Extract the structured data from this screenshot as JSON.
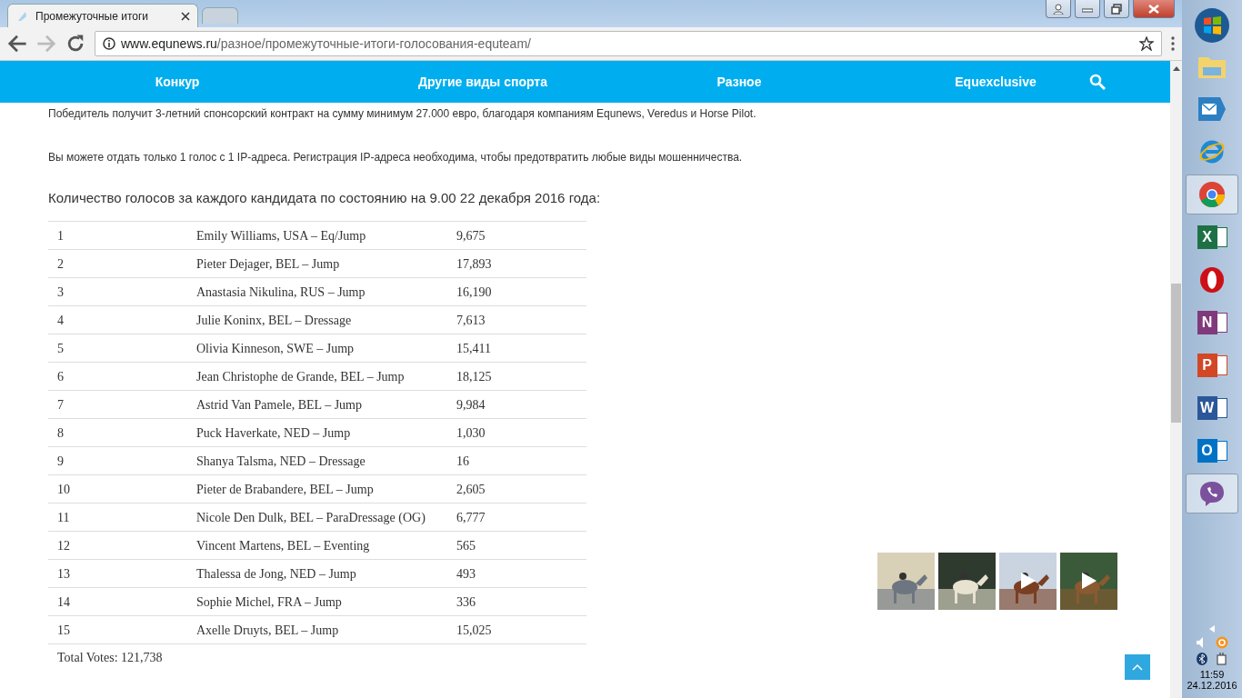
{
  "browser": {
    "tabs": [
      {
        "title": "Промежуточные итоги",
        "selected": true
      },
      {
        "selected": false
      }
    ],
    "url_host": "www.equnews.ru",
    "url_path": "/разное/промежуточные-итоги-голосования-equteam/"
  },
  "nav": {
    "items": [
      "Конкур",
      "Другие виды спорта",
      "Разное",
      "Equexclusive"
    ]
  },
  "paragraphs": [
    "Победитель получит 3-летний спонсорский контракт на сумму минимум  27.000 евро, благодаря компаниям  Equnews, Veredus и Horse Pilot.",
    "Вы можете отдать только 1 голос с 1 IP-адреса. Регистрация IP-адреса необходима, чтобы предотвратить любые виды мошенничества."
  ],
  "heading": "Количество голосов за каждого кандидата по состоянию на 9.00 22 декабря 2016 года:",
  "table": {
    "rows": [
      [
        "1",
        "Emily Williams, USA – Eq/Jump",
        "9,675"
      ],
      [
        "2",
        "Pieter Dejager, BEL – Jump",
        "17,893"
      ],
      [
        "3",
        "Anastasia Nikulina, RUS – Jump",
        "16,190"
      ],
      [
        "4",
        "Julie Koninx, BEL – Dressage",
        "7,613"
      ],
      [
        "5",
        "Olivia Kinneson, SWE – Jump",
        "15,411"
      ],
      [
        "6",
        "Jean Christophe de Grande, BEL – Jump",
        "18,125"
      ],
      [
        "7",
        "Astrid Van Pamele, BEL – Jump",
        "9,984"
      ],
      [
        "8",
        "Puck Haverkate, NED – Jump",
        "1,030"
      ],
      [
        "9",
        "Shanya Talsma, NED – Dressage",
        "16"
      ],
      [
        "10",
        "Pieter de Brabandere, BEL – Jump",
        "2,605"
      ],
      [
        "11",
        "Nicole Den Dulk, BEL – ParaDressage (OG)",
        "6,777"
      ],
      [
        "12",
        "Vincent Martens, BEL – Eventing",
        "565"
      ],
      [
        "13",
        "Thalessa de Jong, NED – Jump",
        "493"
      ],
      [
        "14",
        "Sophie Michel, FRA – Jump",
        "336"
      ],
      [
        "15",
        "Axelle Druyts, BEL – Jump",
        "15,025"
      ]
    ],
    "total": "Total Votes: 121,738"
  },
  "thumbnails": [
    {
      "kind": "picture",
      "video": false
    },
    {
      "kind": "picture",
      "video": false
    },
    {
      "kind": "picture",
      "video": true
    },
    {
      "kind": "picture",
      "video": true
    }
  ],
  "taskbar": {
    "apps": [
      {
        "kind": "explorer",
        "selected": false
      },
      {
        "kind": "mail",
        "selected": false
      },
      {
        "kind": "ie",
        "selected": false
      },
      {
        "kind": "chrome",
        "selected": true
      },
      {
        "kind": "office",
        "letter": "X",
        "color": "#1e7145",
        "selected": false
      },
      {
        "kind": "opera",
        "selected": false
      },
      {
        "kind": "office",
        "letter": "N",
        "color": "#80397b",
        "selected": false
      },
      {
        "kind": "office",
        "letter": "P",
        "color": "#d24726",
        "selected": false
      },
      {
        "kind": "office",
        "letter": "W",
        "color": "#2b579a",
        "selected": false
      },
      {
        "kind": "office",
        "letter": "O",
        "color": "#0072c6",
        "selected": false
      },
      {
        "kind": "viber",
        "selected": true
      }
    ],
    "time": "11:59",
    "date": "24.12.2016"
  }
}
